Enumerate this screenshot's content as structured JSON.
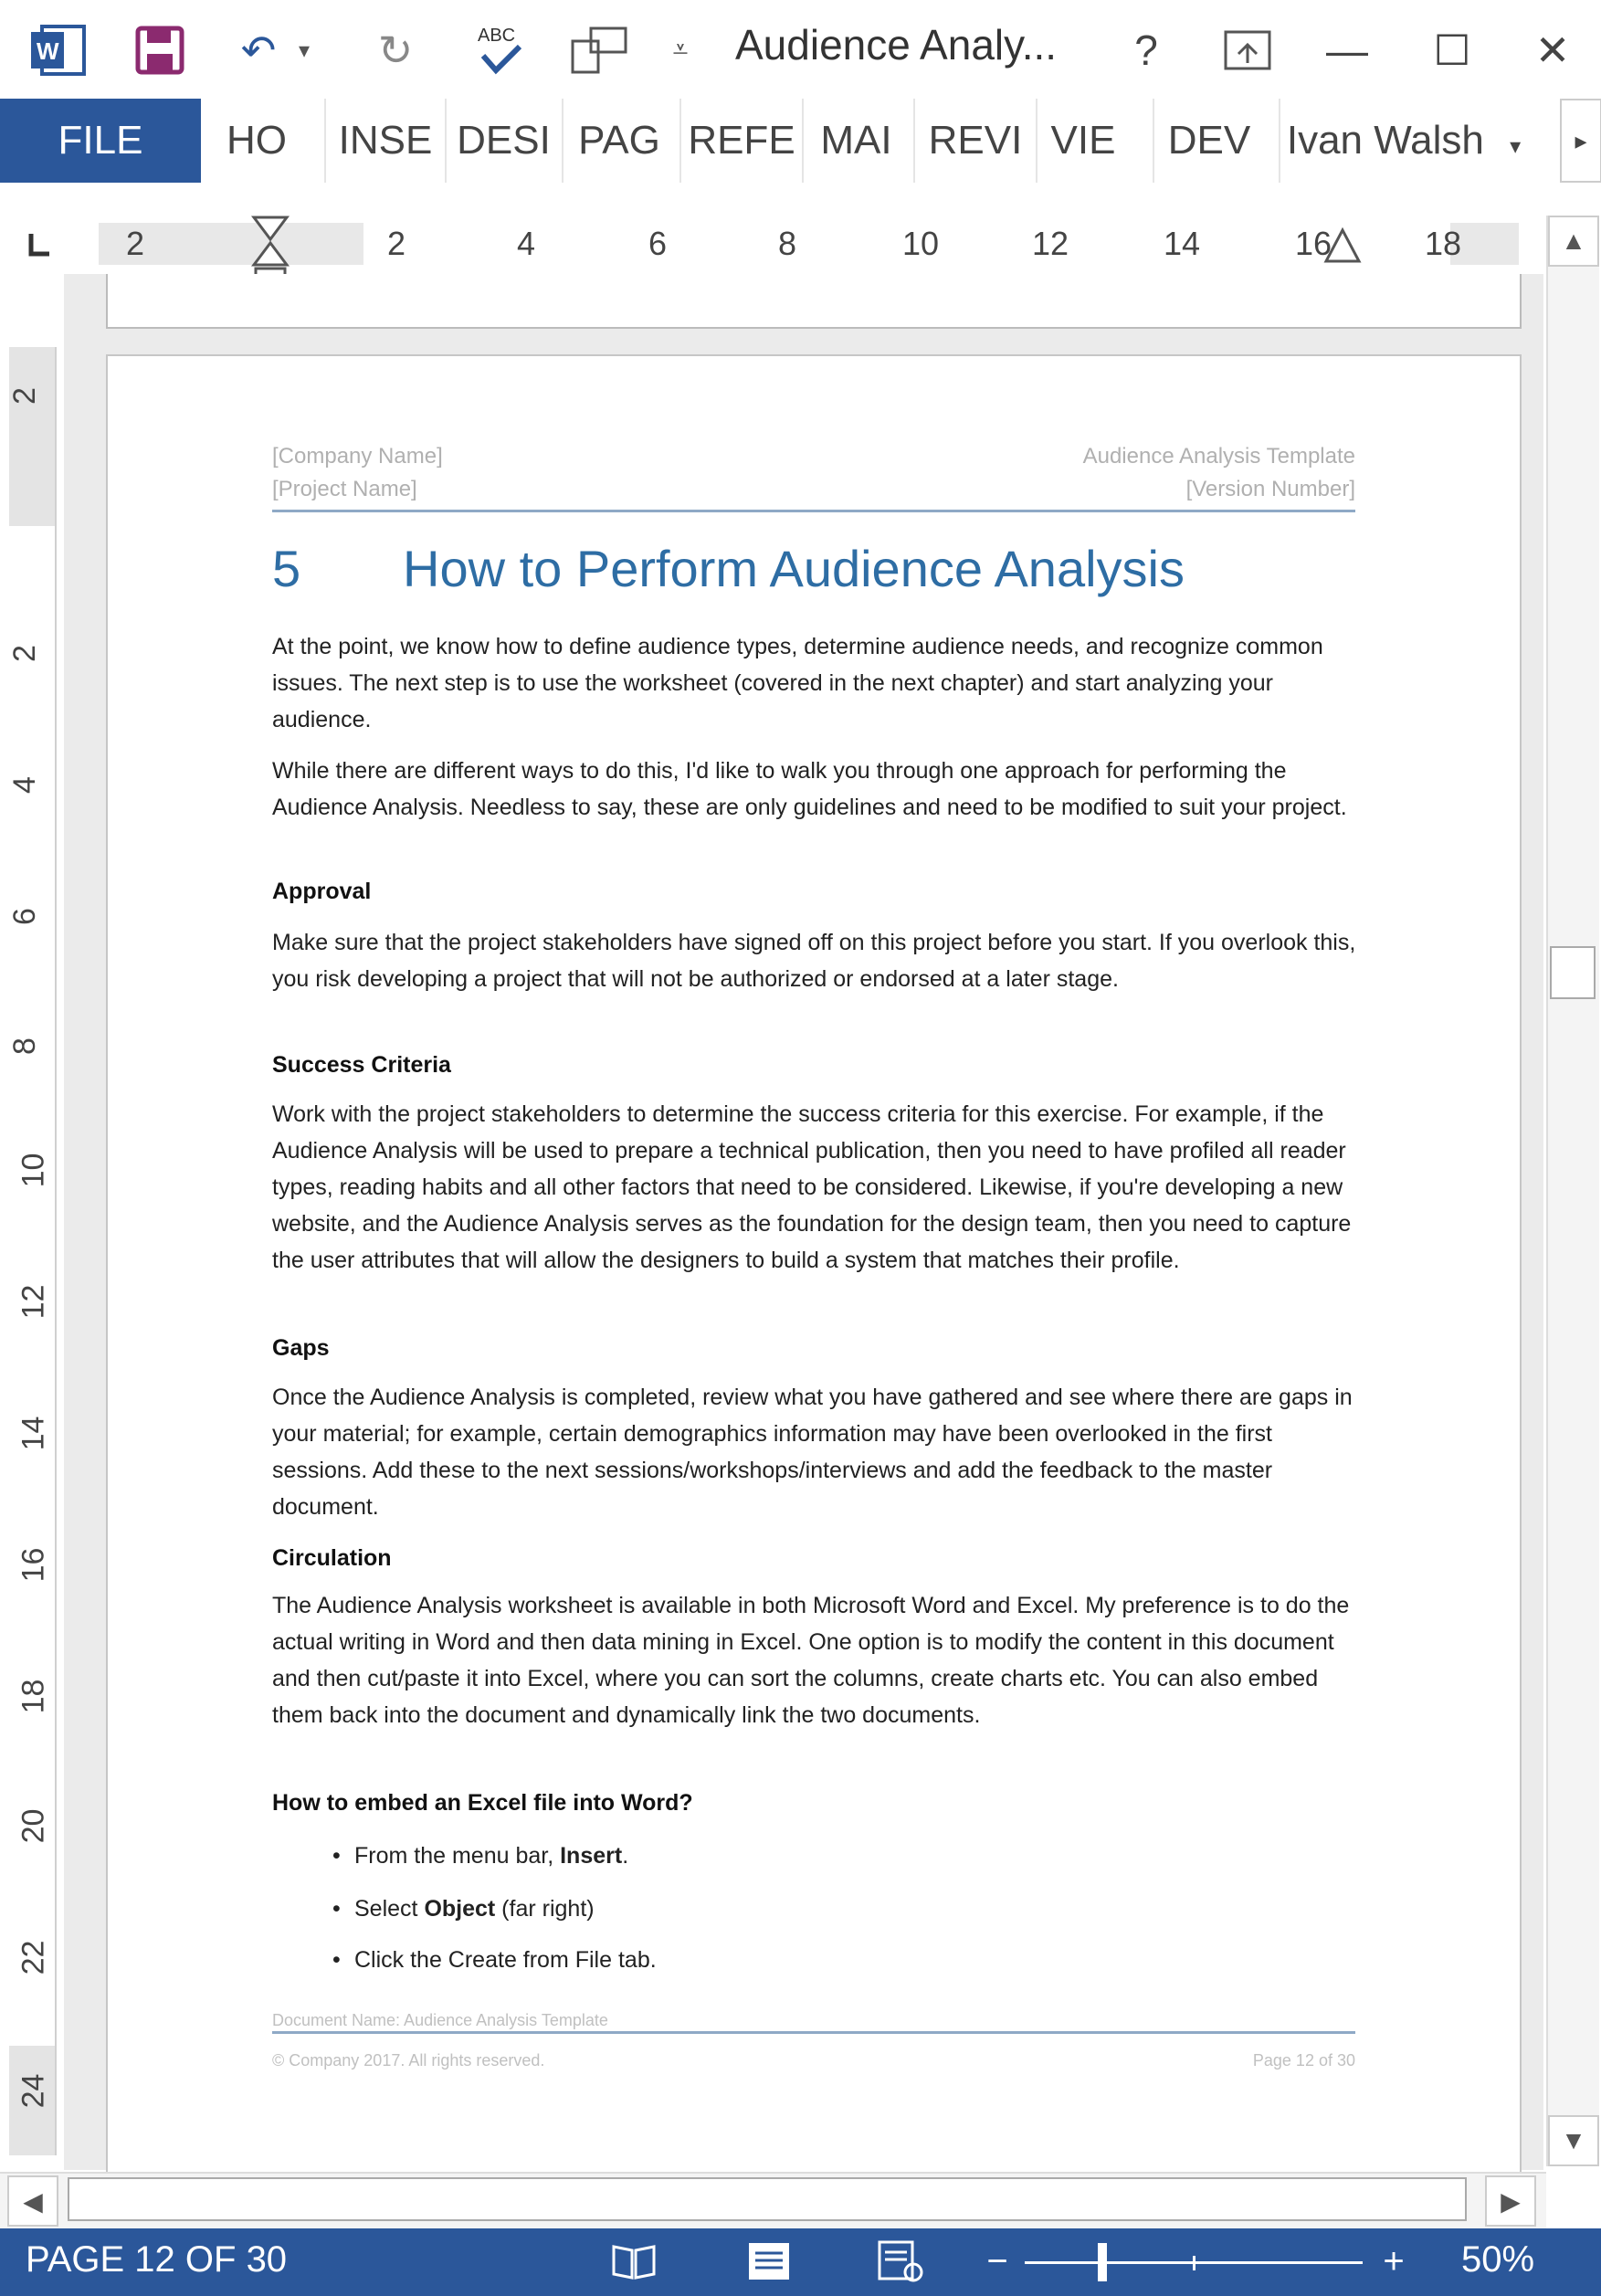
{
  "titlebar": {
    "title": "Audience Analy...",
    "help": "?",
    "minimize": "—",
    "maximize": "☐",
    "close": "✕"
  },
  "ribbon": {
    "tabs": [
      "FILE",
      "HO",
      "INSE",
      "DESI",
      "PAG",
      "REFE",
      "MAI",
      "REVI",
      "VIE",
      "DEV"
    ],
    "user": "Ivan Walsh"
  },
  "ruler": {
    "numbers": [
      "2",
      "2",
      "4",
      "6",
      "8",
      "10",
      "12",
      "14",
      "16",
      "18"
    ]
  },
  "vruler": {
    "numbers": [
      "2",
      "2",
      "4",
      "6",
      "8",
      "10",
      "12",
      "14",
      "16",
      "18",
      "20",
      "22",
      "24"
    ]
  },
  "page": {
    "header": {
      "company": "[Company Name]",
      "project": "[Project Name]",
      "template": "Audience Analysis Template",
      "version": "[Version Number]"
    },
    "chapter_number": "5",
    "chapter_title": "How to Perform Audience Analysis",
    "intro1": "At the point, we know how to define audience types, determine audience needs, and recognize common issues. The next step is to use the worksheet (covered in the next chapter) and start analyzing your audience.",
    "intro2": "While there are different ways to do this, I'd like to walk you through one approach for performing the Audience Analysis. Needless to say, these are only guidelines and need to be modified to suit your project.",
    "approval_heading": "Approval",
    "approval_text": "Make sure that the project stakeholders have signed off on this project before you start. If you overlook this, you risk developing a project that will not be authorized or endorsed at a later stage.",
    "success_heading": "Success Criteria",
    "success_text": "Work with the project stakeholders to determine the success criteria for this exercise. For example, if the Audience Analysis will be used to prepare a technical publication, then you need to have profiled all reader types, reading habits and all other factors that need to be considered. Likewise, if you're developing a new website, and the Audience Analysis serves as the foundation for the design team, then you need to capture the user attributes that will allow the designers to build a system that matches their profile.",
    "gaps_heading": "Gaps",
    "gaps_text": "Once the Audience Analysis is completed, review what you have gathered and see where there are gaps in your material; for example, certain demographics information may have been overlooked in the first sessions. Add these to the next sessions/workshops/interviews and add the feedback to the master document.",
    "circulation_heading": "Circulation",
    "circulation_text": "The Audience Analysis worksheet is available in both Microsoft Word and Excel. My preference is to do the actual writing in Word and then data mining in Excel. One option is to modify the content in this document and then cut/paste it into Excel, where you can sort the columns, create charts etc. You can also embed them back into the document and dynamically link the two documents.",
    "embed_heading": "How to embed an Excel file into Word?",
    "bullet1_pre": "From the menu bar, ",
    "bullet1_bold": "Insert",
    "bullet1_post": ".",
    "bullet2_pre": "Select ",
    "bullet2_bold": "Object",
    "bullet2_post": " (far right)",
    "bullet3": "Click the Create from File tab.",
    "footer": {
      "doc_name": "Document Name: Audience Analysis Template",
      "copyright": "© Company 2017. All rights reserved.",
      "page": "Page 12 of 30"
    }
  },
  "status": {
    "page_count": "PAGE 12 OF 30",
    "zoom_minus": "−",
    "zoom_plus": "+",
    "zoom": "50%",
    "zoom_level_percent": 50
  }
}
